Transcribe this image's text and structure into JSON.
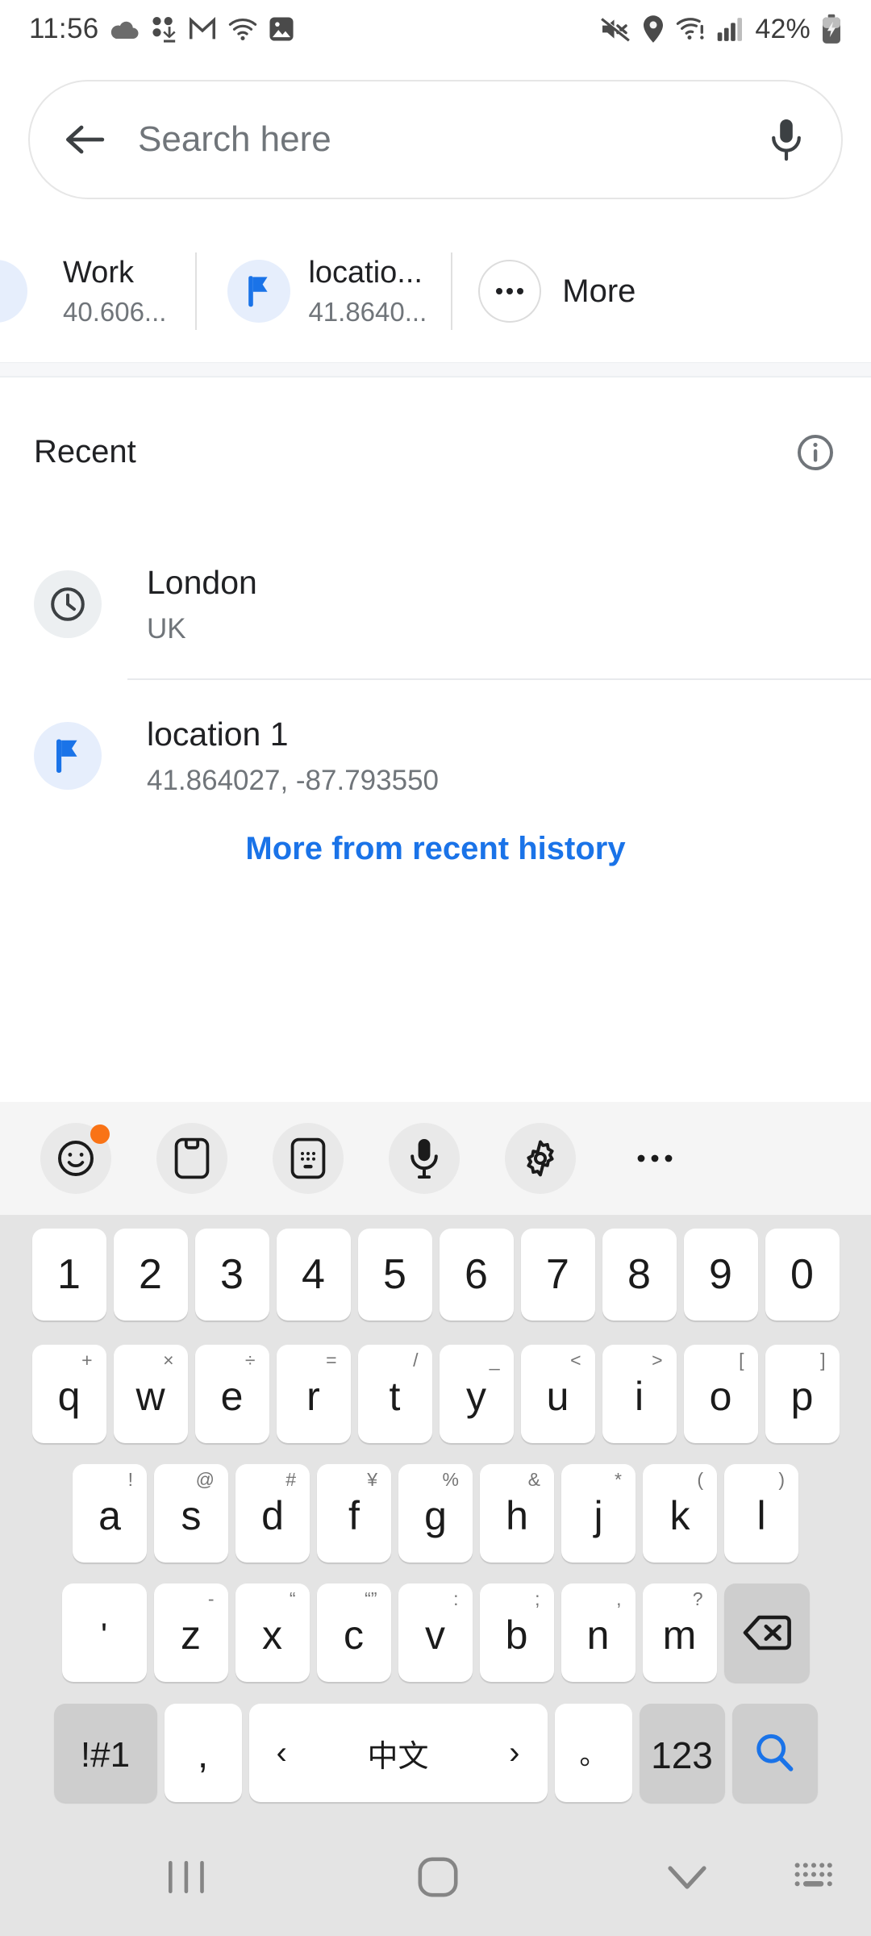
{
  "status_bar": {
    "time": "11:56",
    "battery_percent": "42%",
    "left_icons": [
      "cloud-icon",
      "download-icon",
      "gmail-icon",
      "wifi-question-icon",
      "image-icon"
    ],
    "right_icons": [
      "mute-icon",
      "location-pin-icon",
      "wifi-alert-icon",
      "signal-bars-icon",
      "battery-charging-icon"
    ]
  },
  "search": {
    "placeholder": "Search here",
    "value": "",
    "back_icon": "arrow-left-icon",
    "mic_icon": "microphone-icon"
  },
  "shortcuts": [
    {
      "icon": "pin-icon",
      "title": "",
      "subtitle": "",
      "partial": true
    },
    {
      "icon": "",
      "title": "Work",
      "subtitle": "40.606...",
      "partial": false
    },
    {
      "icon": "flag-icon",
      "title": "locatio...",
      "subtitle": "41.8640...",
      "partial": false
    },
    {
      "icon": "more-dots-icon",
      "title": "More",
      "subtitle": "",
      "partial": false
    }
  ],
  "recent": {
    "heading": "Recent",
    "info_icon": "info-icon",
    "items": [
      {
        "icon": "clock-icon",
        "title": "London",
        "subtitle": "UK"
      },
      {
        "icon": "flag-icon",
        "title": "location 1",
        "subtitle": "41.864027, -87.793550"
      }
    ],
    "more_link": "More from recent history"
  },
  "keyboard": {
    "toolbar": [
      {
        "name": "emoji-icon",
        "badge": true
      },
      {
        "name": "clipboard-icon",
        "badge": false
      },
      {
        "name": "keyboard-mode-icon",
        "badge": false
      },
      {
        "name": "microphone-icon",
        "badge": false
      },
      {
        "name": "settings-gear-icon",
        "badge": false
      },
      {
        "name": "more-dots-icon",
        "badge": false
      }
    ],
    "row_numbers": [
      {
        "key": "1"
      },
      {
        "key": "2"
      },
      {
        "key": "3"
      },
      {
        "key": "4"
      },
      {
        "key": "5"
      },
      {
        "key": "6"
      },
      {
        "key": "7"
      },
      {
        "key": "8"
      },
      {
        "key": "9"
      },
      {
        "key": "0"
      }
    ],
    "row_top": [
      {
        "key": "q",
        "sup": "+"
      },
      {
        "key": "w",
        "sup": "×"
      },
      {
        "key": "e",
        "sup": "÷"
      },
      {
        "key": "r",
        "sup": "="
      },
      {
        "key": "t",
        "sup": "/"
      },
      {
        "key": "y",
        "sup": "_"
      },
      {
        "key": "u",
        "sup": "<"
      },
      {
        "key": "i",
        "sup": ">"
      },
      {
        "key": "o",
        "sup": "["
      },
      {
        "key": "p",
        "sup": "]"
      }
    ],
    "row_home": [
      {
        "key": "a",
        "sup": "!"
      },
      {
        "key": "s",
        "sup": "@"
      },
      {
        "key": "d",
        "sup": "#"
      },
      {
        "key": "f",
        "sup": "¥"
      },
      {
        "key": "g",
        "sup": "%"
      },
      {
        "key": "h",
        "sup": "&"
      },
      {
        "key": "j",
        "sup": "*"
      },
      {
        "key": "k",
        "sup": "("
      },
      {
        "key": "l",
        "sup": ")"
      }
    ],
    "row_bottom": [
      {
        "key": "'",
        "sup": ""
      },
      {
        "key": "z",
        "sup": "-"
      },
      {
        "key": "x",
        "sup": "“"
      },
      {
        "key": "c",
        "sup": "“”"
      },
      {
        "key": "v",
        "sup": ":"
      },
      {
        "key": "b",
        "sup": ";"
      },
      {
        "key": "n",
        "sup": ","
      },
      {
        "key": "m",
        "sup": "?"
      }
    ],
    "backspace_icon": "backspace-icon",
    "row_action": {
      "symbols_key": "!#1",
      "comma_key": ",",
      "space_prev": "‹",
      "space_label": "中文",
      "space_next": "›",
      "period_key": "。",
      "numeric_key": "123",
      "search_icon": "search-icon"
    }
  },
  "navbar": {
    "recents_icon": "recents-icon",
    "home_icon": "home-icon",
    "hide_keyboard_icon": "chevron-down-icon",
    "switch_keyboard_icon": "keyboard-switch-icon"
  },
  "colors": {
    "accent_blue": "#1a73e8",
    "badge_orange": "#f97316",
    "text_primary": "#202124",
    "text_secondary": "#70757a"
  }
}
